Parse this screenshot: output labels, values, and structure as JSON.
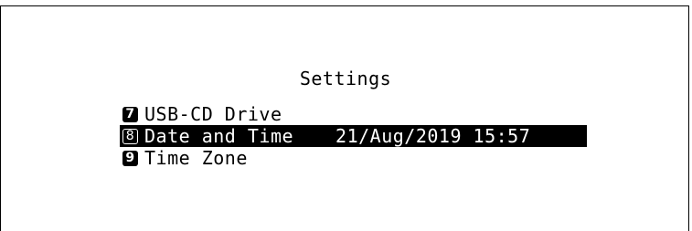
{
  "screen": {
    "title": "Settings"
  },
  "menu": {
    "items": [
      {
        "key": "7",
        "label": "USB-CD Drive",
        "value": "",
        "selected": false
      },
      {
        "key": "8",
        "label": "Date and Time",
        "value": "21/Aug/2019 15:57",
        "selected": true
      },
      {
        "key": "9",
        "label": "Time Zone",
        "value": "",
        "selected": false
      }
    ]
  },
  "colors": {
    "background": "#ffffff",
    "text": "#000000",
    "highlight": "#000000",
    "highlight_text": "#ffffff"
  }
}
